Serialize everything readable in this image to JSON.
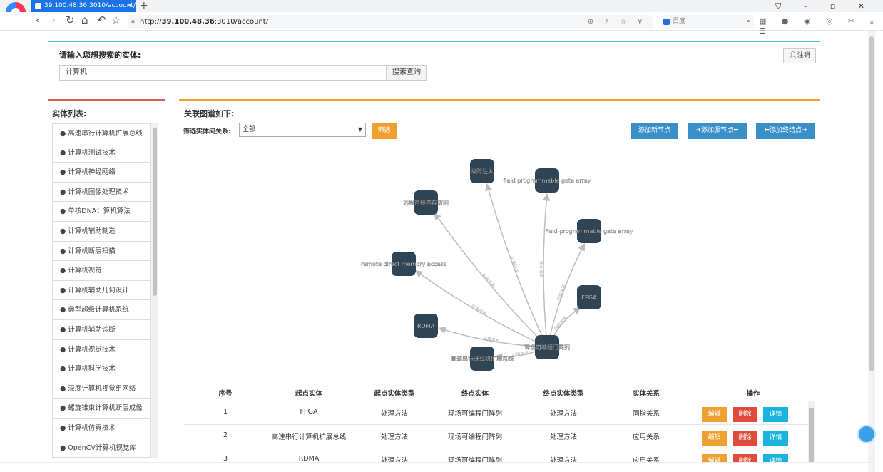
{
  "browser": {
    "tab_title": "39.100.48.36:3010/account/",
    "tab_close": "×",
    "new_tab": "+",
    "window_controls": "⛉ – ▫ ✕",
    "url_prefix": "http://",
    "url_host": "39.100.48.36",
    "url_path": ":3010/account/",
    "url_right_icons": "⊕ ⚡ ☆ ∨",
    "search_placeholder": "百度",
    "search_icon": "⌕",
    "extension_icons": "▦ ● ◉ ◎ ✂ ⤓ ☰"
  },
  "query": {
    "title": "请输入您想搜索的实体:",
    "value": "计算机",
    "button": "搜索查询",
    "logout": "注销"
  },
  "entities": {
    "title": "实体列表:",
    "items": [
      "高速串行计算机扩展总线",
      "计算机测试技术",
      "计算机神经网络",
      "计算机图像处理技术",
      "单核DNA计算机算法",
      "计算机辅助制造",
      "计算机断层扫描",
      "计算机视觉",
      "计算机辅助几何设计",
      "典型超级计算机系统",
      "计算机辅助诊断",
      "计算机视觉技术",
      "计算机科学技术",
      "深度计算机视觉组网络",
      "螺旋锥束计算机断层成像",
      "计算机仿真技术",
      "OpenCV计算机视觉库"
    ]
  },
  "graph": {
    "title": "关联图谱如下:",
    "filter_label": "筛选实体间关系:",
    "filter_value": "全部",
    "filter_button": "筛选",
    "add_node": "添加新节点",
    "add_source": "➜添加源节点⬅",
    "add_target": "⬅添加终结点➜",
    "colors": {
      "node": "#2f4454",
      "edge": "#bdbdbd"
    },
    "center_label": "现场可编程门阵列",
    "nodes": [
      {
        "label": "故障注入",
        "edge": "应用关系"
      },
      {
        "label": "field programmable gate array",
        "edge": "同指关系"
      },
      {
        "label": "远程直接内存访问",
        "edge": "应用关系"
      },
      {
        "label": "field-programmable gate array",
        "edge": "同指关系"
      },
      {
        "label": "remote direct memory access",
        "edge": "应用关系"
      },
      {
        "label": "FPGA",
        "edge": "同指关系"
      },
      {
        "label": "RDMA",
        "edge": "应用关系"
      },
      {
        "label": "高速串行计算机扩展总线",
        "edge": "应用关系"
      }
    ]
  },
  "table": {
    "headers": [
      "序号",
      "起点实体",
      "起点实体类型",
      "终点实体",
      "终点实体类型",
      "实体关系",
      "操作"
    ],
    "rows": [
      [
        "1",
        "FPGA",
        "处理方法",
        "现场可编程门阵列",
        "处理方法",
        "同指关系"
      ],
      [
        "2",
        "高速串行计算机扩展总线",
        "处理方法",
        "现场可编程门阵列",
        "处理方法",
        "应用关系"
      ],
      [
        "3",
        "RDMA",
        "处理方法",
        "现场可编程门阵列",
        "处理方法",
        "应用关系"
      ]
    ],
    "actions": {
      "edit": "编辑",
      "delete": "删除",
      "detail": "详情"
    },
    "action_colors": {
      "edit": "#f0a030",
      "delete": "#e04b3c",
      "detail": "#1ab3e0"
    }
  }
}
